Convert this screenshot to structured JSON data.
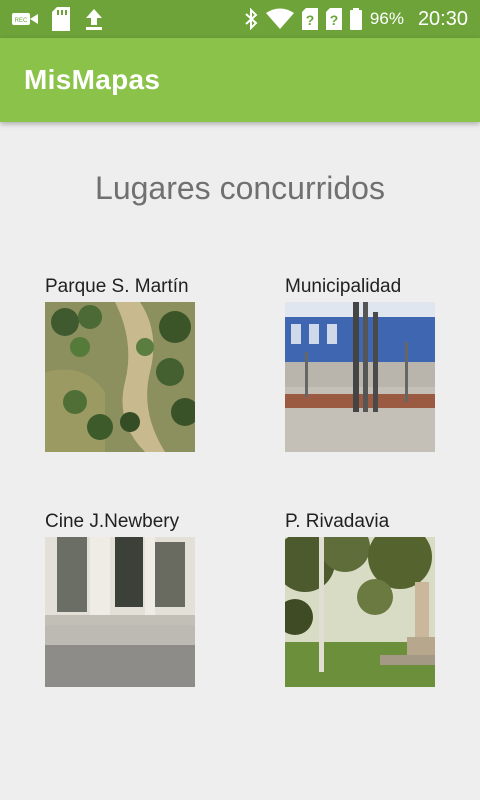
{
  "status_bar": {
    "battery": "96%",
    "time": "20:30",
    "icons": [
      "rec-icon",
      "sd-card-icon",
      "upload-icon",
      "bluetooth-icon",
      "wifi-icon",
      "sim-unknown-icon",
      "sim-unknown-icon",
      "battery-icon"
    ]
  },
  "app_bar": {
    "title": "MisMapas"
  },
  "heading": "Lugares concurridos",
  "places": [
    {
      "label": "Parque S. Martín",
      "image": "park-aerial-photo"
    },
    {
      "label": "Municipalidad",
      "image": "municipal-building-photo"
    },
    {
      "label": "Cine J.Newbery",
      "image": "cinema-facade-photo"
    },
    {
      "label": "P. Rivadavia",
      "image": "plaza-monument-photo"
    }
  ],
  "colors": {
    "status_bar": "#6ea33a",
    "app_bar": "#8bc34a",
    "background": "#eeeeee"
  }
}
